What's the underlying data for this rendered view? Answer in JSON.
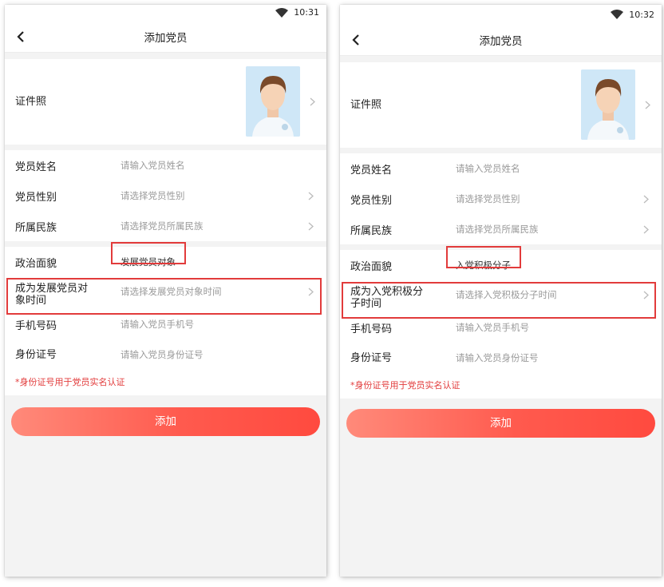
{
  "left": {
    "status_time": "10:31",
    "title": "添加党员",
    "photo_label": "证件照",
    "rows": [
      {
        "label": "党员姓名",
        "value": "请输入党员姓名"
      },
      {
        "label": "党员性别",
        "value": "请选择党员性别"
      },
      {
        "label": "所属民族",
        "value": "请选择党员所属民族"
      }
    ],
    "political_label": "政治面貌",
    "political_value": "发展党员对象",
    "time_label_line1": "成为发展党员对",
    "time_label_line2": "象时间",
    "time_value": "请选择发展党员对象时间",
    "phone_label": "手机号码",
    "phone_value": "请输入党员手机号",
    "id_label": "身份证号",
    "id_value": "请输入党员身份证号",
    "note": "*身份证号用于党员实名认证",
    "add_button": "添加"
  },
  "right": {
    "status_time": "10:32",
    "title": "添加党员",
    "photo_label": "证件照",
    "rows": [
      {
        "label": "党员姓名",
        "value": "请输入党员姓名"
      },
      {
        "label": "党员性别",
        "value": "请选择党员性别"
      },
      {
        "label": "所属民族",
        "value": "请选择党员所属民族"
      }
    ],
    "political_label": "政治面貌",
    "political_value": "入党积极分子",
    "time_label_line1": "成为入党积极分",
    "time_label_line2": "子时间",
    "time_value": "请选择入党积极分子时间",
    "phone_label": "手机号码",
    "phone_value": "请输入党员手机号",
    "id_label": "身份证号",
    "id_value": "请输入党员身份证号",
    "note": "*身份证号用于党员实名认证",
    "add_button": "添加"
  },
  "colors": {
    "accent": "#ff5a4e",
    "highlight": "#e23b3b",
    "placeholder": "#9a9a9a",
    "avatar_bg": "#cfe7f7"
  },
  "icons": [
    "wifi-icon",
    "back-arrow-icon",
    "chevron-right-icon",
    "avatar-placeholder-icon"
  ]
}
